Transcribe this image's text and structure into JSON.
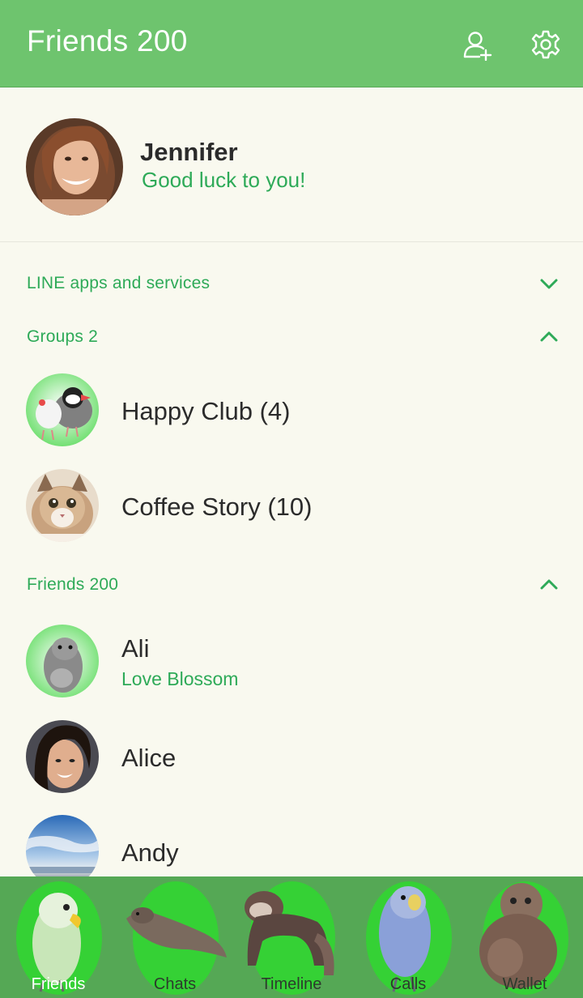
{
  "header": {
    "title": "Friends 200",
    "add_friend_icon": "add-person-icon",
    "settings_icon": "gear-icon"
  },
  "profile": {
    "name": "Jennifer",
    "status": "Good luck to you!"
  },
  "sections": {
    "services": {
      "label": "LINE apps and services",
      "state": "collapsed"
    },
    "groups": {
      "label": "Groups 2",
      "state": "expanded"
    },
    "friends": {
      "label": "Friends 200",
      "state": "expanded"
    }
  },
  "groups": [
    {
      "name": "Happy Club (4)"
    },
    {
      "name": "Coffee Story (10)"
    }
  ],
  "friends": [
    {
      "name": "Ali",
      "status": "Love Blossom"
    },
    {
      "name": "Alice"
    },
    {
      "name": "Andy"
    }
  ],
  "tabs": [
    {
      "label": "Friends",
      "active": true
    },
    {
      "label": "Chats"
    },
    {
      "label": "Timeline"
    },
    {
      "label": "Calls"
    },
    {
      "label": "Wallet"
    }
  ],
  "colors": {
    "header": "#6ec46e",
    "accent_text": "#2eaa58",
    "background": "#f9f9ef",
    "tabbar": "#55a855",
    "tab_blob": "#35d135"
  }
}
